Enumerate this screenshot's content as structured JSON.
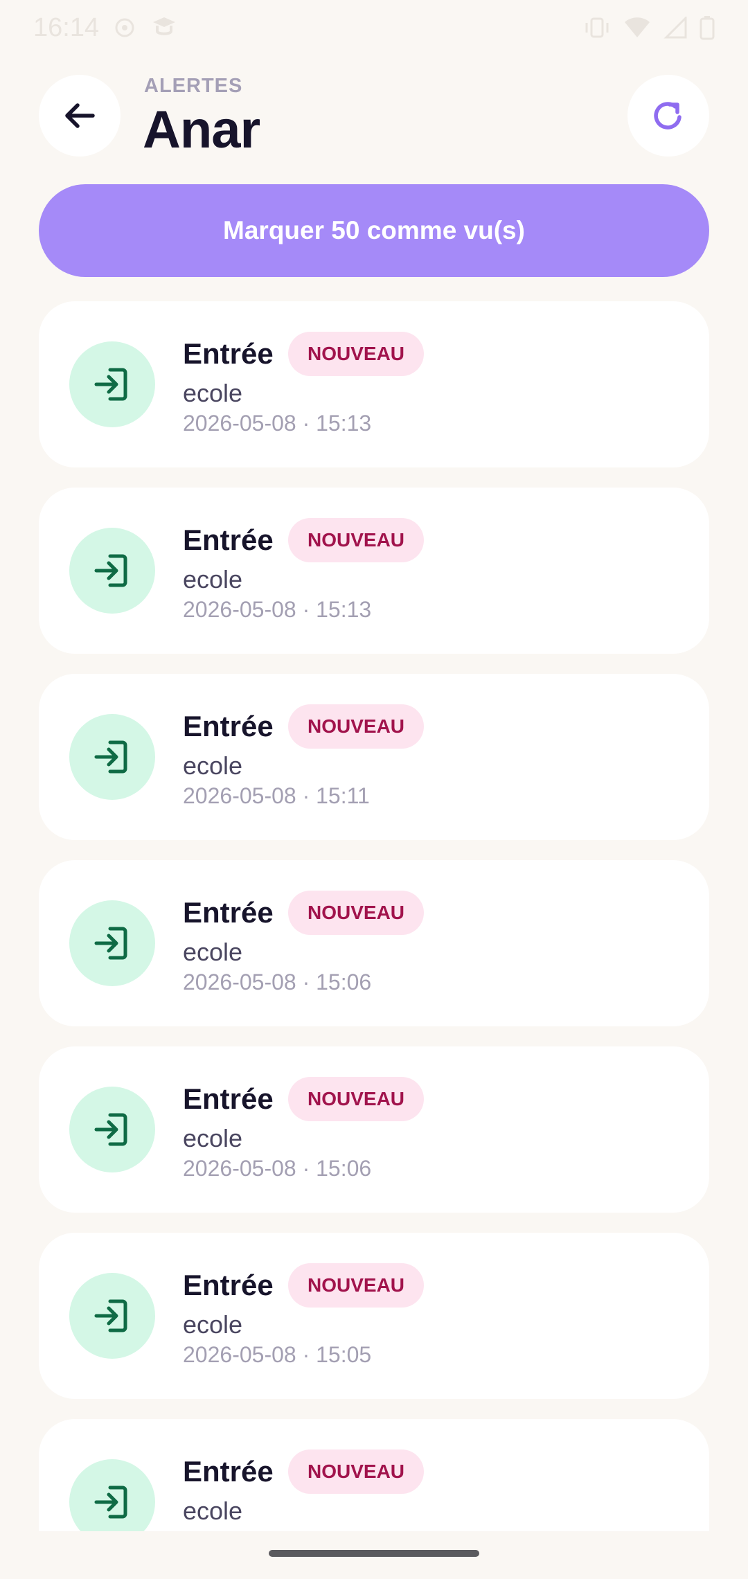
{
  "status_bar": {
    "time": "16:14"
  },
  "header": {
    "eyebrow": "ALERTES",
    "title": "Anar",
    "back_icon": "arrow-left-icon",
    "refresh_icon": "refresh-icon"
  },
  "actions": {
    "mark_seen_label": "Marquer 50 comme vu(s)"
  },
  "alerts": [
    {
      "title": "Entrée",
      "badge": "NOUVEAU",
      "place": "ecole",
      "timestamp": "2026-05-08 · 15:13"
    },
    {
      "title": "Entrée",
      "badge": "NOUVEAU",
      "place": "ecole",
      "timestamp": "2026-05-08 · 15:13"
    },
    {
      "title": "Entrée",
      "badge": "NOUVEAU",
      "place": "ecole",
      "timestamp": "2026-05-08 · 15:11"
    },
    {
      "title": "Entrée",
      "badge": "NOUVEAU",
      "place": "ecole",
      "timestamp": "2026-05-08 · 15:06"
    },
    {
      "title": "Entrée",
      "badge": "NOUVEAU",
      "place": "ecole",
      "timestamp": "2026-05-08 · 15:06"
    },
    {
      "title": "Entrée",
      "badge": "NOUVEAU",
      "place": "ecole",
      "timestamp": "2026-05-08 · 15:05"
    },
    {
      "title": "Entrée",
      "badge": "NOUVEAU",
      "place": "ecole",
      "timestamp": ""
    }
  ],
  "colors": {
    "background": "#faf7f3",
    "accent": "#a58af8",
    "icon_bg": "#d4f7e6",
    "icon_fg": "#0f6b45",
    "badge_bg": "#fde4ef",
    "badge_fg": "#a1134c"
  }
}
